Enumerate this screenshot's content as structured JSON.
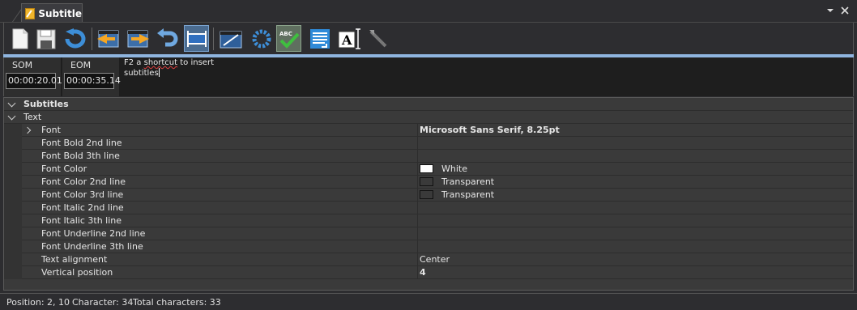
{
  "window": {
    "tab_title": "Subtitle",
    "controls": [
      "chevron-down-icon",
      "close-icon"
    ]
  },
  "toolbar": {
    "buttons": [
      {
        "name": "new-document-icon"
      },
      {
        "name": "save-icon"
      },
      {
        "name": "undo-icon"
      },
      {
        "name": "previous-clip-icon"
      },
      {
        "name": "next-clip-icon"
      },
      {
        "name": "redo-arrow-icon"
      },
      {
        "name": "fit-frame-icon",
        "active": true
      },
      {
        "name": "video-settings-icon"
      },
      {
        "name": "refresh-icon"
      },
      {
        "name": "spell-check-icon",
        "label": "ABC",
        "checked": true
      },
      {
        "name": "text-list-icon"
      },
      {
        "name": "text-cursor-icon",
        "label": "A"
      },
      {
        "name": "tools-icon"
      }
    ]
  },
  "timecode": {
    "som_label": "SOM",
    "som_value": "00:00:20.01",
    "eom_label": "EOM",
    "eom_value": "00:00:35.14"
  },
  "editor": {
    "line1_prefix": "F2 a ",
    "line1_squiggle": "shortcut",
    "line1_suffix": " to insert",
    "line2": "subtitles"
  },
  "properties": {
    "category": "Subtitles",
    "subcategory": "Text",
    "rows": [
      {
        "name": "Font",
        "value": "Microsoft Sans Serif, 8.25pt",
        "bold": true,
        "expandable": true
      },
      {
        "name": "Font Bold 2nd line",
        "value": ""
      },
      {
        "name": "Font Bold 3th line",
        "value": ""
      },
      {
        "name": "Font Color",
        "value": "White",
        "swatch": "#ffffff"
      },
      {
        "name": "Font Color 2nd line",
        "value": "Transparent",
        "swatch": "#3a3a3a"
      },
      {
        "name": "Font Color 3rd line",
        "value": "Transparent",
        "swatch": "#3a3a3a"
      },
      {
        "name": "Font Italic 2nd line",
        "value": ""
      },
      {
        "name": "Font Italic 3th line",
        "value": ""
      },
      {
        "name": "Font Underline 2nd line",
        "value": ""
      },
      {
        "name": "Font Underline 3th line",
        "value": ""
      },
      {
        "name": "Text alignment",
        "value": "Center"
      },
      {
        "name": "Vertical position",
        "value": "4",
        "bold": true
      }
    ]
  },
  "status": {
    "position": "Position: 2, 10",
    "character": "Character: 34",
    "total": "Total characters: 33"
  },
  "colors": {
    "accent": "#8fb5df",
    "background": "#2d2d30",
    "grid": "#3a3a3a"
  }
}
